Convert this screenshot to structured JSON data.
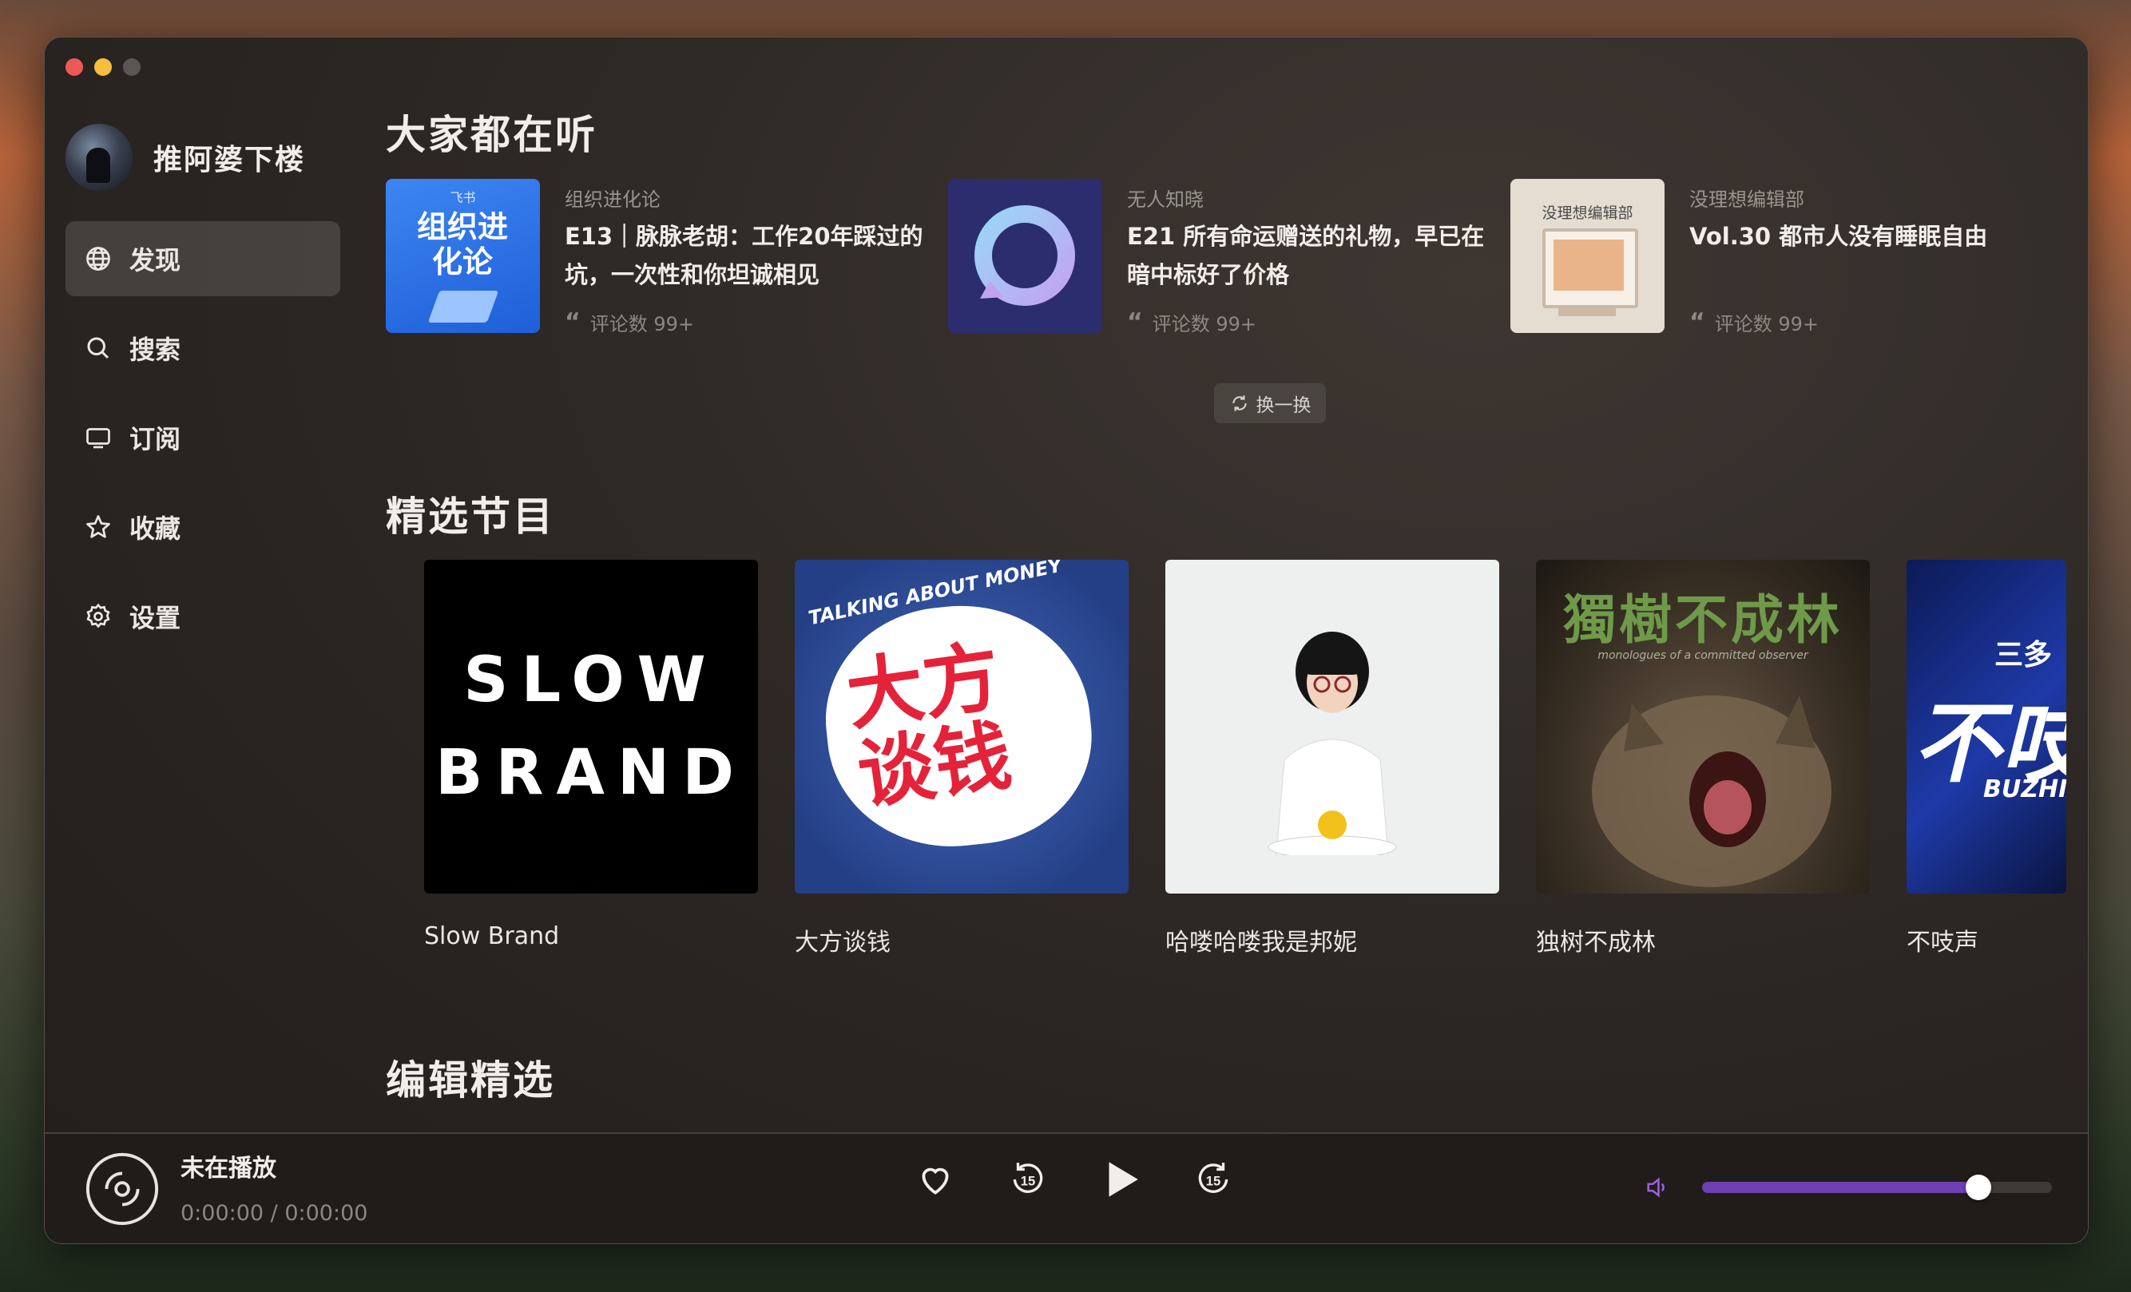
{
  "sidebar": {
    "user_name": "推阿婆下楼",
    "items": [
      {
        "label": "发现",
        "icon": "globe-icon"
      },
      {
        "label": "搜索",
        "icon": "search-icon"
      },
      {
        "label": "订阅",
        "icon": "tv-icon"
      },
      {
        "label": "收藏",
        "icon": "star-icon"
      },
      {
        "label": "设置",
        "icon": "gear-icon"
      }
    ],
    "active_index": 0
  },
  "main": {
    "popular": {
      "title": "大家都在听",
      "items": [
        {
          "podcast": "组织进化论",
          "title": "E13｜脉脉老胡：工作20年踩过的坑，一次性和你坦诚相见",
          "comments": "评论数 99+",
          "cover_text_top": "飞书",
          "cover_text": "组织进化论",
          "cover_color": "#2f6fe6"
        },
        {
          "podcast": "无人知晓",
          "title": "E21 所有命运赠送的礼物，早已在暗中标好了价格",
          "comments": "评论数 99+",
          "cover_color": "#2b2d6e"
        },
        {
          "podcast": "没理想编辑部",
          "title": "Vol.30 都市人没有睡眠自由",
          "comments": "评论数 99+",
          "cover_text": "没理想编辑部",
          "cover_color": "#e6ddd2"
        }
      ],
      "refresh_label": "换一换"
    },
    "featured": {
      "title": "精选节目",
      "items": [
        {
          "name": "Slow Brand",
          "cover_line1": "SLOW",
          "cover_line2": "BRAND"
        },
        {
          "name": "大方谈钱",
          "cover_top": "TALKING ABOUT MONEY",
          "cover_line1": "大方",
          "cover_line2": "谈钱"
        },
        {
          "name": "哈喽哈喽我是邦妮"
        },
        {
          "name": "独树不成林",
          "cover_title": "獨樹不成林",
          "cover_sub": "monologues of a committed observer"
        },
        {
          "name": "不吱声",
          "cover_small": "三多",
          "cover_big": "不吱",
          "cover_en": "BUZHI"
        }
      ]
    },
    "editor": {
      "title": "编辑精选"
    }
  },
  "player": {
    "status": "未在播放",
    "time": "0:00:00 / 0:00:00",
    "volume": 0.79,
    "accent": "#6f3fb4"
  }
}
